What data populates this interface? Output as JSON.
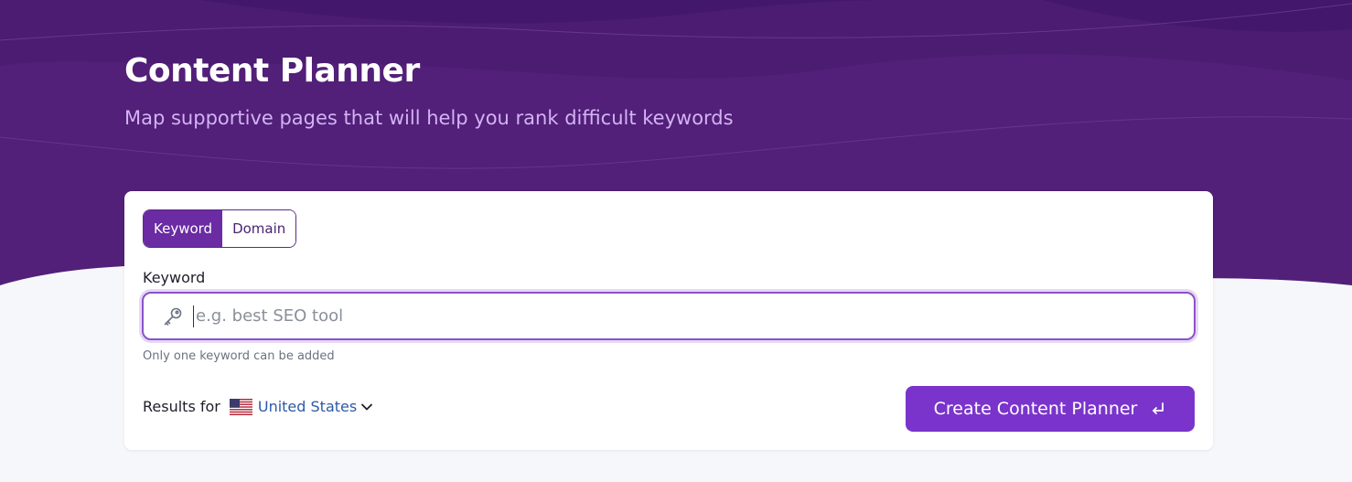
{
  "header": {
    "title": "Content Planner",
    "subtitle": "Map supportive pages that will help you rank difficult keywords"
  },
  "form": {
    "toggle": {
      "options": [
        "Keyword",
        "Domain"
      ],
      "selected": "Keyword"
    },
    "keyword_label": "Keyword",
    "keyword_input": {
      "value": "",
      "placeholder": "e.g. best SEO tool",
      "icon": "key-icon"
    },
    "helper_text": "Only one keyword can be added",
    "results_for_label": "Results for",
    "country": {
      "selected": "United States",
      "flag_icon": "us-flag-icon"
    },
    "submit_label": "Create Content Planner",
    "submit_icon": "enter-icon"
  },
  "colors": {
    "hero_bg": "#521f79",
    "accent": "#7a34cc",
    "subtitle": "#d3b3f4",
    "link": "#2c5aa8"
  }
}
